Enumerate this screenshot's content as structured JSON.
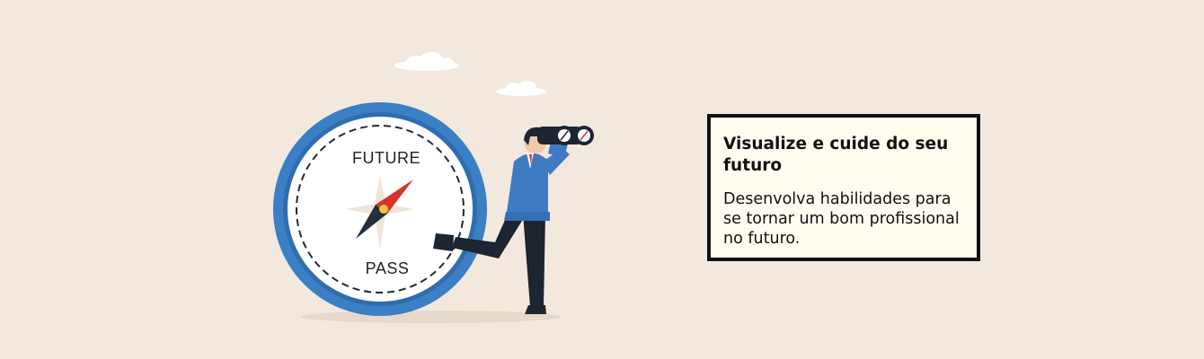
{
  "banner": {
    "card": {
      "title": "Visualize e cuide do seu futuro",
      "body": "Desenvolva habilidades para se tornar um bom profissional no futuro."
    },
    "compass": {
      "top_label": "FUTURE",
      "bottom_label": "PASS"
    },
    "colors": {
      "background": "#f2e8de",
      "compass_blue": "#3b7fc4",
      "needle_red": "#d8322f",
      "needle_dark": "#23303f",
      "jacket_blue": "#3f7bc3",
      "card_background": "#fffdf0"
    }
  }
}
